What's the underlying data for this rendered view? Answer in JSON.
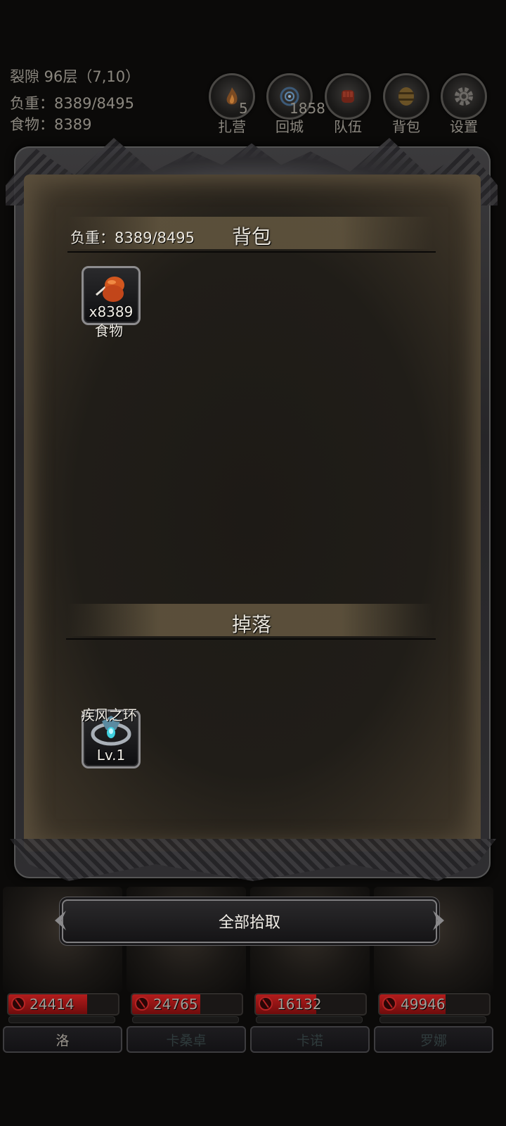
{
  "status": {
    "location": "裂隙 96层（7,10）",
    "weight": "负重：8389/8495",
    "food": "食物：8389"
  },
  "menu": [
    {
      "id": "camp",
      "label": "扎营",
      "badge": "5",
      "icon": "campfire-icon"
    },
    {
      "id": "town",
      "label": "回城",
      "badge": "1858",
      "icon": "portal-icon"
    },
    {
      "id": "team",
      "label": "队伍",
      "badge": "",
      "icon": "fist-icon"
    },
    {
      "id": "bag",
      "label": "背包",
      "badge": "",
      "icon": "barrel-icon"
    },
    {
      "id": "settings",
      "label": "设置",
      "badge": "",
      "icon": "gear-icon"
    }
  ],
  "backpack": {
    "title": "背包",
    "weight": "负重：8389/8495",
    "items": [
      {
        "name": "食物",
        "count": "x8389",
        "icon": "meat-icon"
      }
    ]
  },
  "drops": {
    "title": "掉落",
    "items": [
      {
        "name": "疾风之环",
        "count": "Lv.1",
        "icon": "ring-icon"
      }
    ]
  },
  "pickup_button": "全部拾取",
  "heroes": [
    {
      "hp": "24414",
      "hp_fraction": 0.72,
      "name": "洛"
    },
    {
      "hp": "24765",
      "hp_fraction": 0.62,
      "name": "卡桑卓"
    },
    {
      "hp": "16132",
      "hp_fraction": 0.55,
      "name": "卡诺"
    },
    {
      "hp": "49946",
      "hp_fraction": 0.6,
      "name": "罗娜"
    }
  ],
  "colors": {
    "hp_red": "#b31c1c",
    "parchment": "#201d18",
    "text_gray": "#8b877f"
  }
}
